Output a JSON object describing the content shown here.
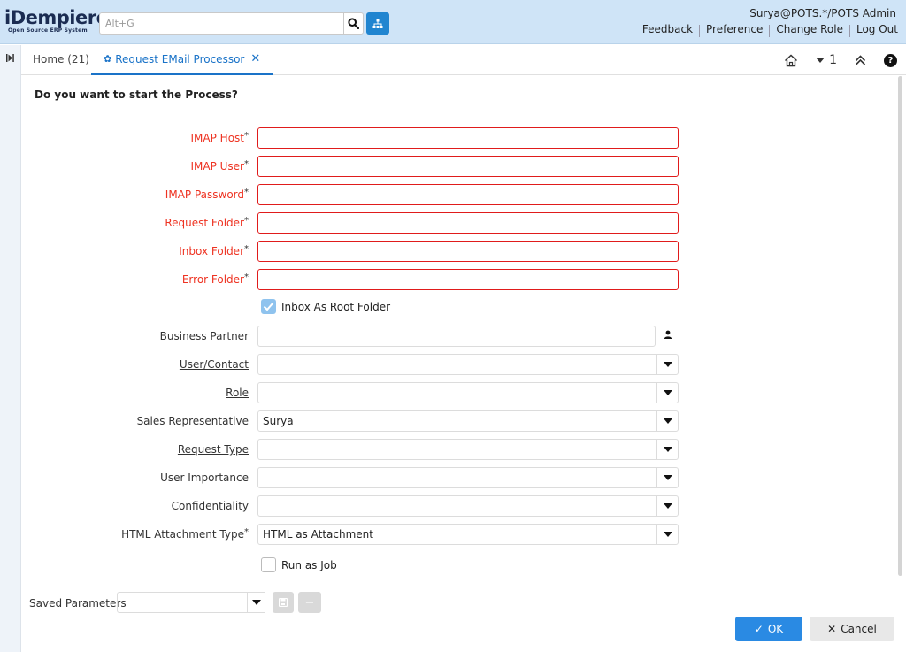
{
  "header": {
    "logo_main": "iDempiere",
    "logo_sub": "Open Source ERP System",
    "search_placeholder": "Alt+G",
    "user": "Surya@POTS.*/POTS Admin",
    "links": [
      "Feedback",
      "Preference",
      "Change Role",
      "Log Out"
    ]
  },
  "tabs": {
    "home": "Home (21)",
    "active": "Request EMail Processor",
    "badge": "1"
  },
  "form": {
    "question": "Do you want to start the Process?",
    "fields": {
      "imap_host": "IMAP Host",
      "imap_user": "IMAP User",
      "imap_password": "IMAP Password",
      "request_folder": "Request Folder",
      "inbox_folder": "Inbox Folder",
      "error_folder": "Error Folder",
      "inbox_root": "Inbox As Root Folder",
      "business_partner": "Business Partner",
      "user_contact": "User/Contact",
      "role": "Role",
      "sales_rep": "Sales Representative",
      "request_type": "Request Type",
      "user_importance": "User Importance",
      "confidentiality": "Confidentiality",
      "html_attachment_type": "HTML Attachment Type",
      "run_as_job": "Run as Job"
    },
    "values": {
      "sales_rep": "Surya",
      "html_attachment_type": "HTML as Attachment"
    },
    "inbox_root_checked": true,
    "run_as_job_checked": false
  },
  "footer": {
    "saved_parameters": "Saved Parameters",
    "ok": "OK",
    "cancel": "Cancel"
  },
  "colors": {
    "header_bg": "#cfe4f7",
    "accent": "#2a8ae3",
    "required": "#e01b1b"
  }
}
